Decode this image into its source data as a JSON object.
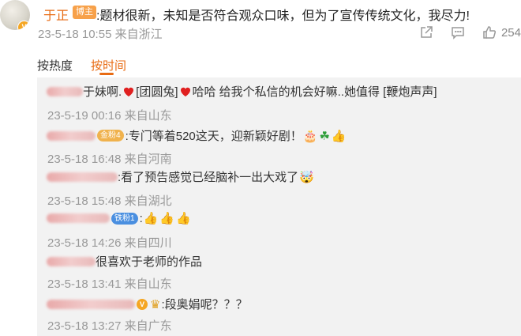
{
  "post": {
    "author": "于正",
    "badge": "博主",
    "text": ":题材很新，未知是否符合观众口味，但为了宣传传统文化，我尽力!",
    "meta": "23-5-18 10:55 来自浙江",
    "like_count": "254",
    "verified_mark": "V"
  },
  "icons": {
    "share": "share-icon",
    "comment": "comment-icon",
    "like": "thumbs-up-icon"
  },
  "sort": {
    "hot": "按热度",
    "time": "按时间"
  },
  "colors": {
    "accent": "#e86b13",
    "meta": "#999999",
    "panel": "#f2f2f2"
  },
  "replies": [
    {
      "text_a": "于妹啊.",
      "text_b": "[团圆兔]",
      "text_c": "哈哈  给我个私信的机会好嘛..她值得 [鞭炮声声]",
      "meta": "23-5-19 00:16 来自山东"
    },
    {
      "badge": "金粉4",
      "text": ":专门等着520这天，迎新颖好剧！",
      "meta": "23-5-18 16:48 来自河南"
    },
    {
      "text": ":看了预告感觉已经脑补一出大戏了",
      "meta": "23-5-18 15:48 来自湖北"
    },
    {
      "badge": "铁粉1",
      "text": ":",
      "meta": "23-5-18 14:26 来自四川"
    },
    {
      "text": "很喜欢于老师的作品",
      "meta": "23-5-18 13:41 来自山东"
    },
    {
      "text": ":段奥娟呢？？？",
      "meta": "23-5-18 13:27 来自广东"
    }
  ]
}
